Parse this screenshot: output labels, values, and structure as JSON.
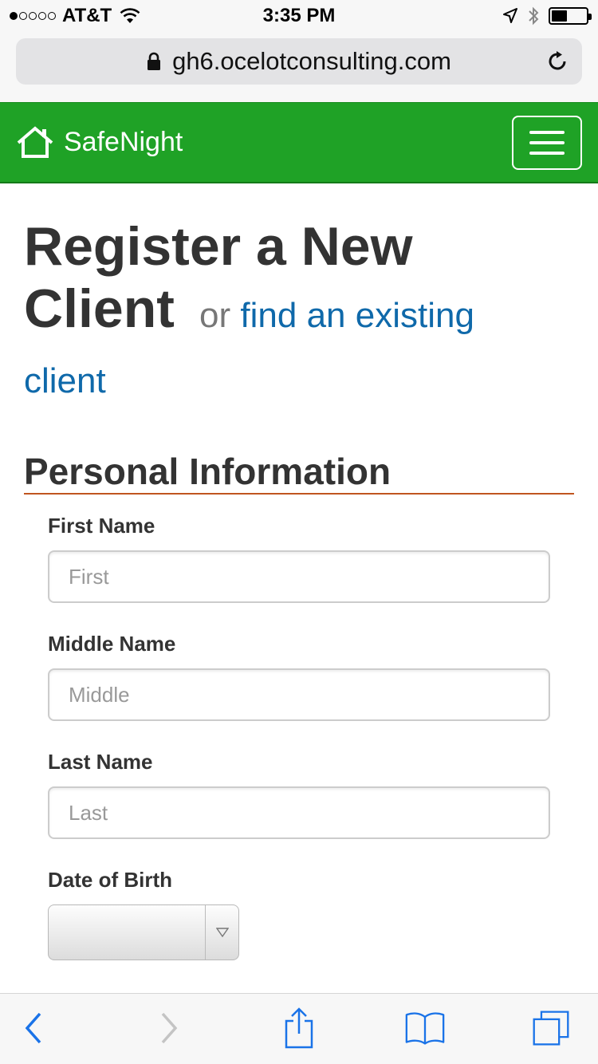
{
  "status_bar": {
    "carrier": "AT&T",
    "time": "3:35 PM",
    "signal_bars_filled": 1,
    "signal_bars_total": 5,
    "battery_level": 0.45
  },
  "browser": {
    "url": "gh6.ocelotconsulting.com",
    "icons": [
      "lock-icon",
      "reload-icon",
      "back-icon",
      "forward-icon",
      "share-icon",
      "bookmarks-icon",
      "tabs-icon"
    ]
  },
  "navbar": {
    "brand": "SafeNight",
    "brand_color": "#1fa226",
    "icons": [
      "house-icon",
      "hamburger-menu-icon"
    ]
  },
  "page": {
    "title_line1": "Register a New",
    "title_line2": "Client",
    "or_text": "or",
    "find_link_part1": "find an existing",
    "find_link_part2": "client",
    "link_color": "#0f69aa"
  },
  "form": {
    "section_title": "Personal Information",
    "first_name": {
      "label": "First Name",
      "placeholder": "First",
      "value": ""
    },
    "middle_name": {
      "label": "Middle Name",
      "placeholder": "Middle",
      "value": ""
    },
    "last_name": {
      "label": "Last Name",
      "placeholder": "Last",
      "value": ""
    },
    "dob": {
      "label": "Date of Birth",
      "selected": ""
    }
  }
}
